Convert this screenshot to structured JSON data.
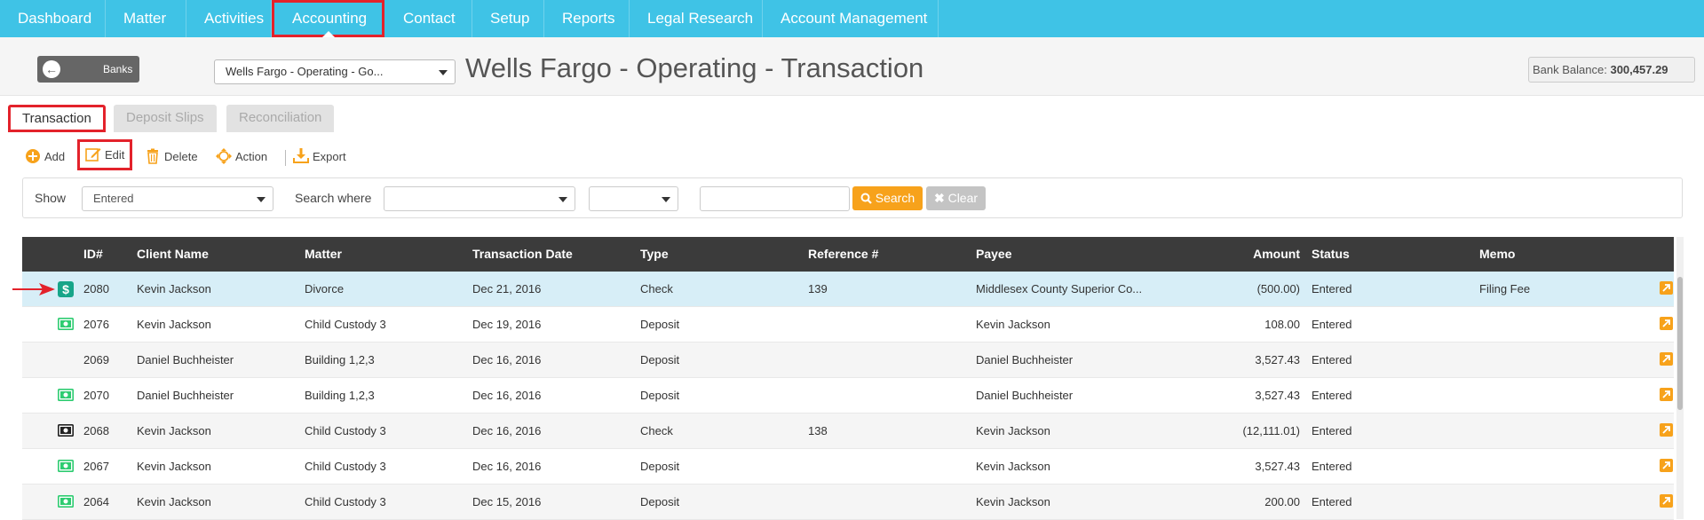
{
  "nav": {
    "items": [
      {
        "label": "Dashboard"
      },
      {
        "label": "Matter"
      },
      {
        "label": "Activities"
      },
      {
        "label": "Accounting"
      },
      {
        "label": "Contact"
      },
      {
        "label": "Setup"
      },
      {
        "label": "Reports"
      },
      {
        "label": "Legal Research"
      },
      {
        "label": "Account Management"
      }
    ],
    "active": "Accounting"
  },
  "header": {
    "back_label": "Banks",
    "bank_select_value": "Wells Fargo - Operating - Go...",
    "title": "Wells Fargo - Operating - Transaction",
    "balance_label": "Bank Balance:",
    "balance_value": "300,457.29"
  },
  "tabs": [
    {
      "label": "Transaction",
      "active": true
    },
    {
      "label": "Deposit Slips",
      "active": false
    },
    {
      "label": "Reconciliation",
      "active": false
    }
  ],
  "toolbar": {
    "add_label": "Add",
    "edit_label": "Edit",
    "delete_label": "Delete",
    "action_label": "Action",
    "export_label": "Export"
  },
  "filter": {
    "show_label": "Show",
    "show_value": "Entered",
    "search_where_label": "Search where",
    "field_value": "",
    "operator_value": "",
    "search_text": "",
    "search_button": "Search",
    "clear_button": "Clear"
  },
  "table": {
    "columns": [
      "ID#",
      "Client Name",
      "Matter",
      "Transaction Date",
      "Type",
      "Reference #",
      "Payee",
      "Amount",
      "Status",
      "Memo"
    ],
    "rows": [
      {
        "icon": "check-icon",
        "id": "2080",
        "client": "Kevin Jackson",
        "matter": "Divorce",
        "date": "Dec 21, 2016",
        "type": "Check",
        "ref": "139",
        "payee": "Middlesex County Superior Co...",
        "amount": "(500.00)",
        "status": "Entered",
        "memo": "Filing Fee"
      },
      {
        "icon": "deposit-icon",
        "id": "2076",
        "client": "Kevin Jackson",
        "matter": "Child Custody 3",
        "date": "Dec 19, 2016",
        "type": "Deposit",
        "ref": "",
        "payee": "Kevin Jackson",
        "amount": "108.00",
        "status": "Entered",
        "memo": ""
      },
      {
        "icon": "",
        "id": "2069",
        "client": "Daniel Buchheister",
        "matter": "Building 1,2,3",
        "date": "Dec 16, 2016",
        "type": "Deposit",
        "ref": "",
        "payee": "Daniel Buchheister",
        "amount": "3,527.43",
        "status": "Entered",
        "memo": ""
      },
      {
        "icon": "deposit-icon",
        "id": "2070",
        "client": "Daniel Buchheister",
        "matter": "Building 1,2,3",
        "date": "Dec 16, 2016",
        "type": "Deposit",
        "ref": "",
        "payee": "Daniel Buchheister",
        "amount": "3,527.43",
        "status": "Entered",
        "memo": ""
      },
      {
        "icon": "cash-icon",
        "id": "2068",
        "client": "Kevin Jackson",
        "matter": "Child Custody 3",
        "date": "Dec 16, 2016",
        "type": "Check",
        "ref": "138",
        "payee": "Kevin Jackson",
        "amount": "(12,111.01)",
        "status": "Entered",
        "memo": ""
      },
      {
        "icon": "deposit-icon",
        "id": "2067",
        "client": "Kevin Jackson",
        "matter": "Child Custody 3",
        "date": "Dec 16, 2016",
        "type": "Deposit",
        "ref": "",
        "payee": "Kevin Jackson",
        "amount": "3,527.43",
        "status": "Entered",
        "memo": ""
      },
      {
        "icon": "deposit-icon",
        "id": "2064",
        "client": "Kevin Jackson",
        "matter": "Child Custody 3",
        "date": "Dec 15, 2016",
        "type": "Deposit",
        "ref": "",
        "payee": "Kevin Jackson",
        "amount": "200.00",
        "status": "Entered",
        "memo": ""
      }
    ]
  },
  "colors": {
    "nav_bg": "#3fc3e6",
    "accent_orange": "#f7a21b",
    "highlight_red": "#e3222b",
    "selected_row": "#d7eef7",
    "table_header": "#3b3b3b"
  }
}
